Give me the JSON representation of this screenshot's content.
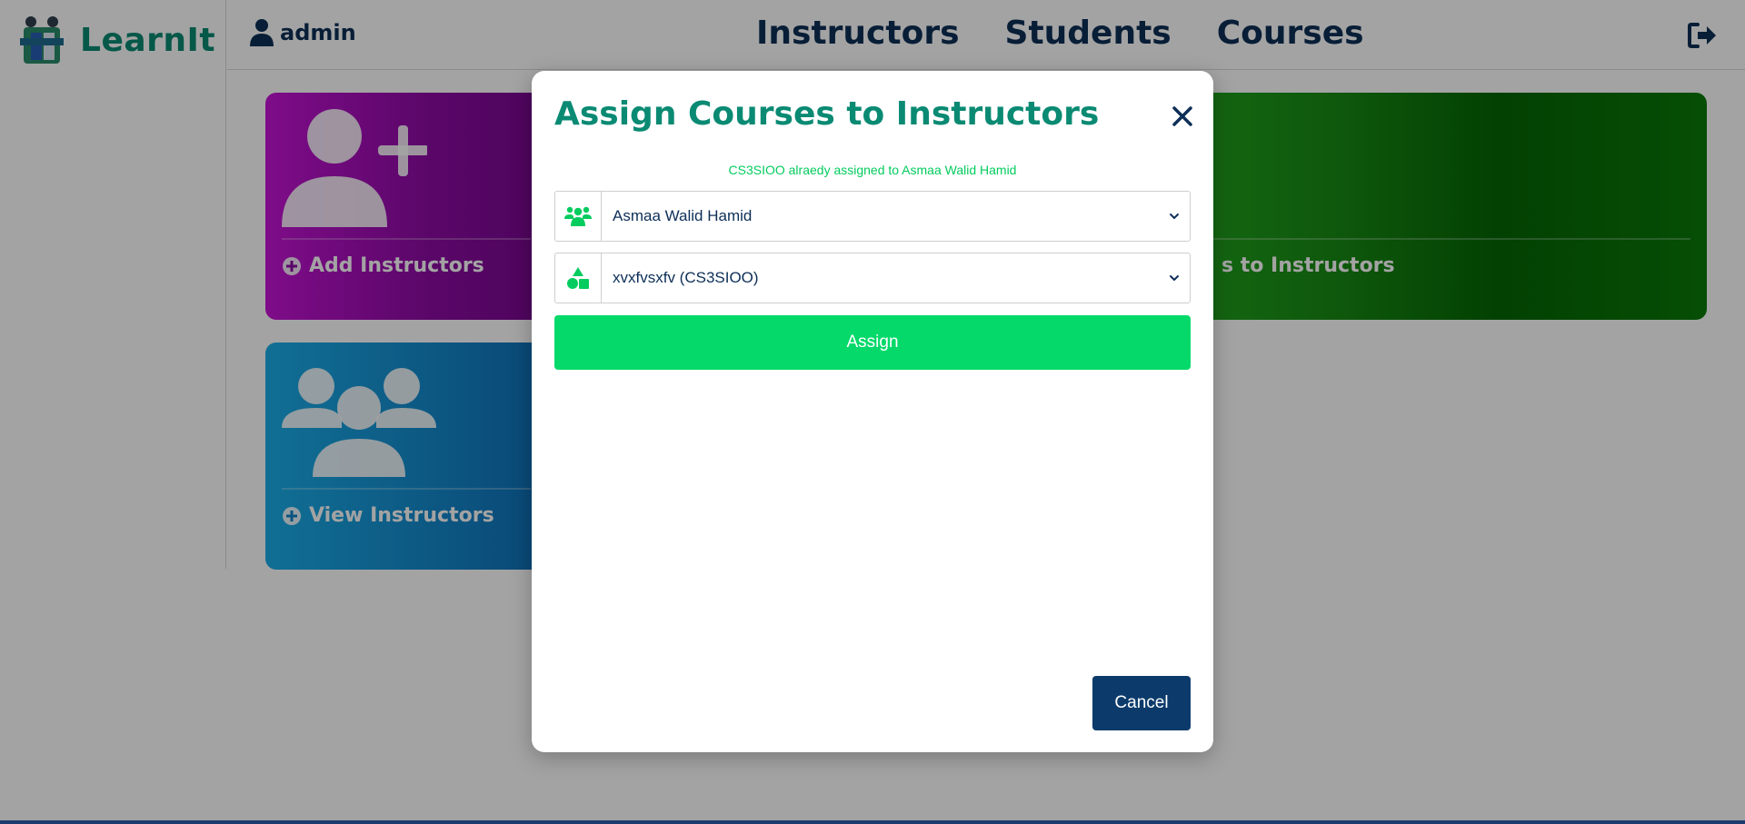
{
  "app": {
    "name": "LearnIt"
  },
  "header": {
    "user": "admin",
    "nav": [
      "Instructors",
      "Students",
      "Courses"
    ]
  },
  "cards": {
    "add_instructors": "Add Instructors",
    "view_instructors": "View Instructors",
    "assign_partial": "s to Instructors"
  },
  "modal": {
    "title": "Assign Courses to Instructors",
    "message": "CS3SIOO alraedy assigned to Asmaa Walid Hamid",
    "instructor_select": {
      "value": "Asmaa Walid Hamid"
    },
    "course_select": {
      "value": "xvxfvsxfv (CS3SIOO)"
    },
    "assign_label": "Assign",
    "cancel_label": "Cancel"
  },
  "colors": {
    "brand_teal": "#0a8a73",
    "navy": "#0d2f57",
    "green_accent": "#04d96a",
    "cancel_navy": "#0c3b6b"
  },
  "icons": [
    "logo-icon",
    "user-icon",
    "logout-icon",
    "add-user-icon",
    "users-icon",
    "plus-circle-icon",
    "close-icon",
    "user-group-icon",
    "shapes-icon",
    "chevron-down-icon"
  ]
}
